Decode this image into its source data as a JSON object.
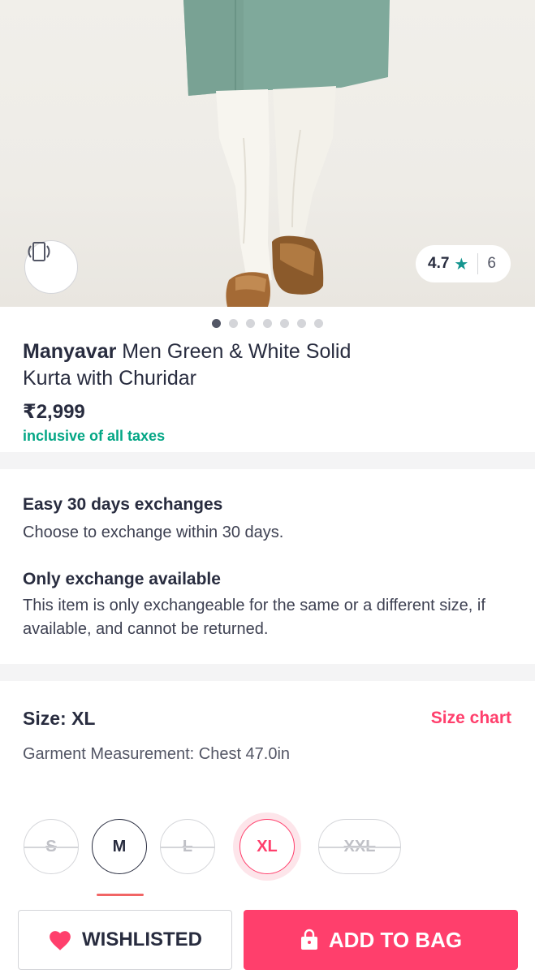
{
  "product": {
    "brand": "Manyavar",
    "name_line1": " Men Green & White Solid",
    "name_line2": "Kurta with Churidar",
    "price": "₹2,999",
    "tax_note": "inclusive of all taxes"
  },
  "rating": {
    "value": "4.7",
    "star": "★",
    "count": "6"
  },
  "carousel": {
    "total": 7,
    "active": 0
  },
  "exchange": {
    "title1": "Easy 30 days exchanges",
    "text1": "Choose to exchange within 30 days.",
    "title2": "Only exchange available",
    "text2": "This item is only exchangeable for the same or a different size, if available, and cannot be returned."
  },
  "size": {
    "label": "Size: XL",
    "chart_link": "Size chart",
    "garment": "Garment Measurement: Chest 47.0in",
    "options": [
      {
        "label": "S",
        "state": "out-of-stock"
      },
      {
        "label": "M",
        "state": "available"
      },
      {
        "label": "L",
        "state": "out-of-stock"
      },
      {
        "label": "XL",
        "state": "selected"
      },
      {
        "label": "XXL",
        "state": "out-of-stock"
      }
    ]
  },
  "actions": {
    "wishlist": "WISHLISTED",
    "add_to_bag": "ADD TO BAG"
  },
  "colors": {
    "accent": "#ff3f6c",
    "rating_star": "#14958f",
    "tax_green": "#03a685",
    "text": "#282c3f"
  },
  "icons": [
    "rotate-360-icon",
    "star-icon",
    "heart-icon",
    "bag-lock-icon"
  ]
}
